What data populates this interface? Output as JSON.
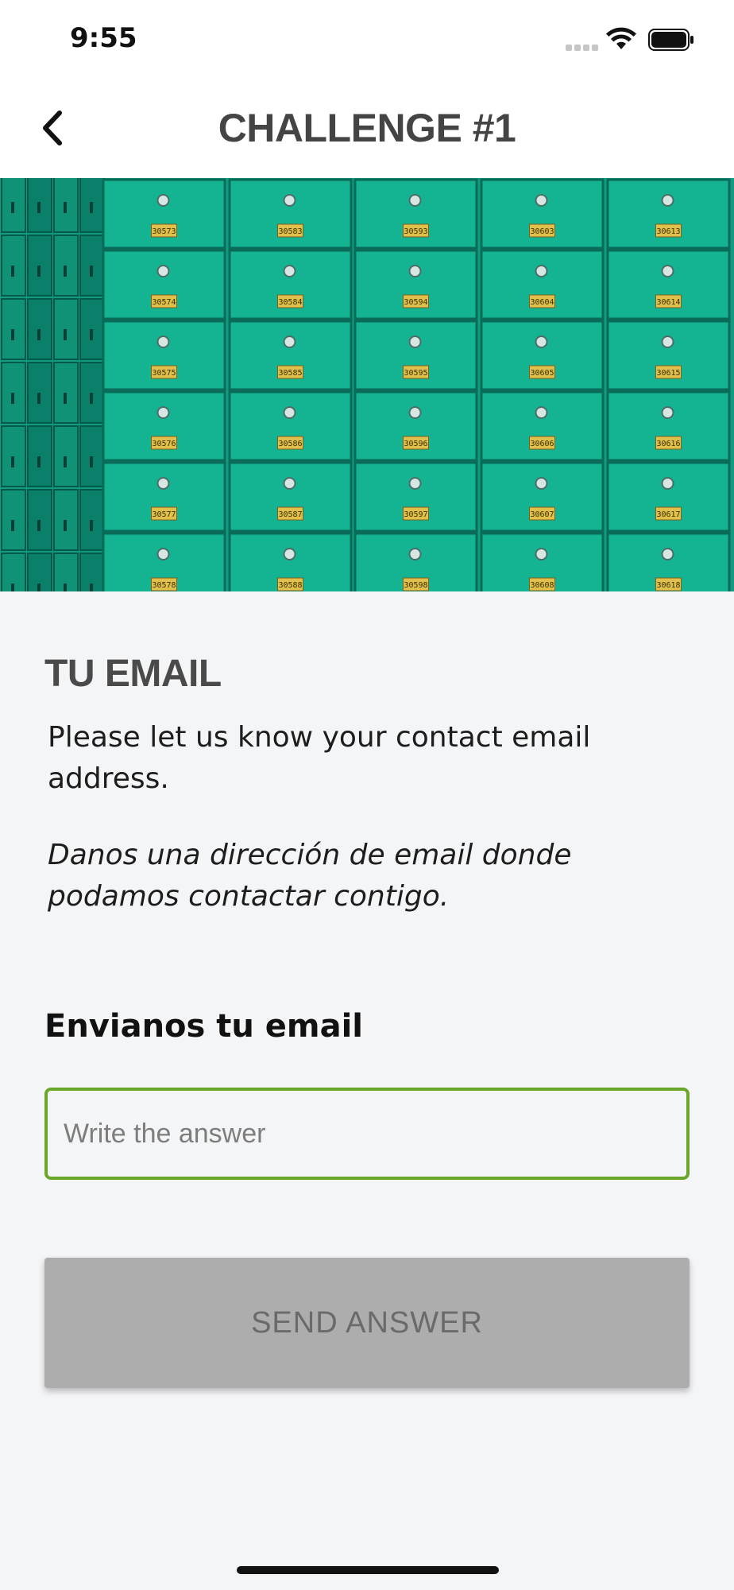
{
  "status_bar": {
    "time": "9:55"
  },
  "nav": {
    "title": "CHALLENGE #1",
    "back_icon": "chevron-left-icon"
  },
  "hero": {
    "description_icon": "safe-deposit-boxes-image",
    "box_numbers": [
      [
        "30573",
        "30583",
        "30593",
        "30603",
        "30613"
      ],
      [
        "30574",
        "30584",
        "30594",
        "30604",
        "30614"
      ],
      [
        "30575",
        "30585",
        "30595",
        "30605",
        "30615"
      ],
      [
        "30576",
        "30586",
        "30596",
        "30606",
        "30616"
      ],
      [
        "30577",
        "30587",
        "30597",
        "30607",
        "30617"
      ],
      [
        "30578",
        "30588",
        "30598",
        "30608",
        "30618"
      ]
    ]
  },
  "content": {
    "section_title": "TU EMAIL",
    "description_en": "Please let us know your contact email address.",
    "description_es": "Danos una dirección de email donde podamos contactar contigo.",
    "field_label": "Envianos tu email",
    "input": {
      "value": "",
      "placeholder": "Write the answer"
    },
    "send_label": "SEND ANSWER"
  },
  "colors": {
    "accent_border": "#6aa62a",
    "button_disabled": "#adadad",
    "hero_teal": "#12a98a"
  }
}
